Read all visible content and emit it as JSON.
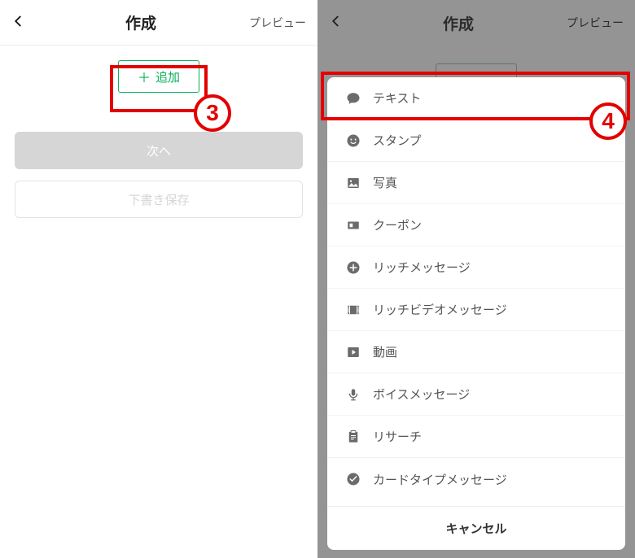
{
  "header": {
    "title": "作成",
    "preview": "プレビュー"
  },
  "left": {
    "add_label": "追加",
    "next_label": "次へ",
    "draft_label": "下書き保存",
    "badge": "3"
  },
  "right": {
    "badge": "4",
    "menu": [
      {
        "label": "テキスト",
        "icon": "chat"
      },
      {
        "label": "スタンプ",
        "icon": "smile"
      },
      {
        "label": "写真",
        "icon": "image"
      },
      {
        "label": "クーポン",
        "icon": "ticket"
      },
      {
        "label": "リッチメッセージ",
        "icon": "plus-circle"
      },
      {
        "label": "リッチビデオメッセージ",
        "icon": "film"
      },
      {
        "label": "動画",
        "icon": "play"
      },
      {
        "label": "ボイスメッセージ",
        "icon": "mic"
      },
      {
        "label": "リサーチ",
        "icon": "clipboard"
      },
      {
        "label": "カードタイプメッセージ",
        "icon": "card"
      }
    ],
    "cancel_label": "キャンセル"
  }
}
